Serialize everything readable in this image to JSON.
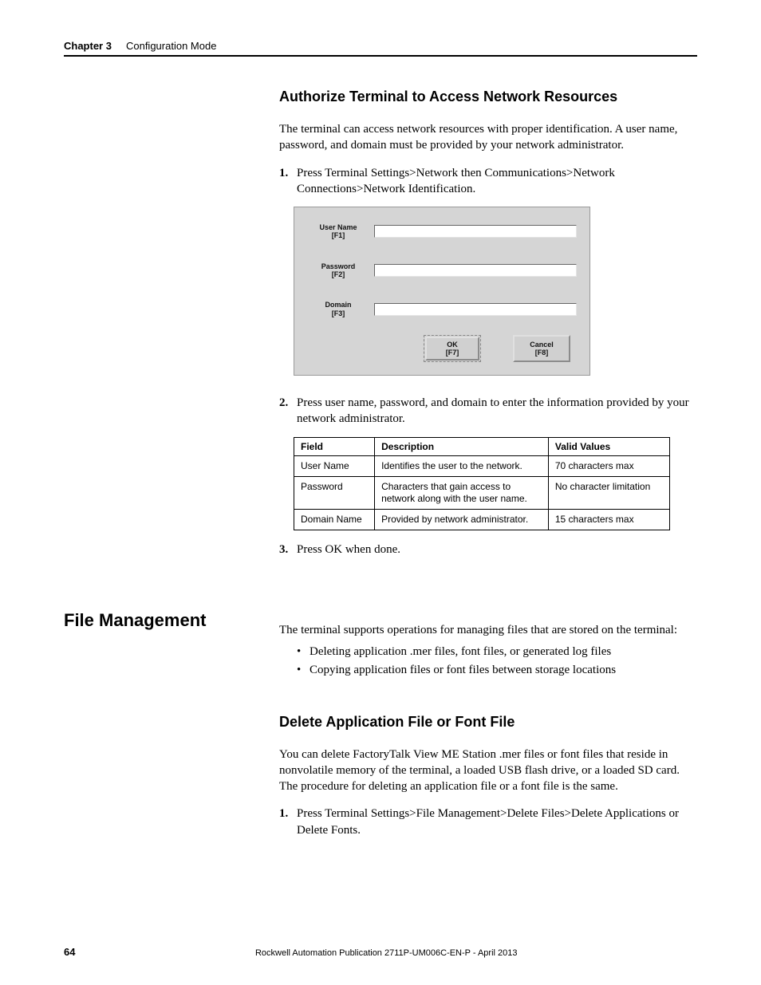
{
  "header": {
    "chapter_label": "Chapter 3",
    "chapter_title": "Configuration Mode"
  },
  "section1": {
    "heading": "Authorize Terminal to Access Network Resources",
    "intro": "The terminal can access network resources with proper identification. A user name, password, and domain must be provided by your network administrator.",
    "step1": "Press Terminal Settings>Network then Communications>Network Connections>Network Identification.",
    "step2": "Press user name, password, and domain to enter the information provided by your network administrator.",
    "step3": "Press OK when done."
  },
  "dialog": {
    "user_label": "User Name\n[F1]",
    "pass_label": "Password\n[F2]",
    "domain_label": "Domain\n[F3]",
    "ok_label": "OK\n[F7]",
    "cancel_label": "Cancel\n[F8]"
  },
  "table": {
    "headers": {
      "field": "Field",
      "desc": "Description",
      "valid": "Valid Values"
    },
    "rows": [
      {
        "field": "User Name",
        "desc": "Identifies the user to the network.",
        "valid": "70 characters max"
      },
      {
        "field": "Password",
        "desc": "Characters that gain access to network along with the user name.",
        "valid": "No character limitation"
      },
      {
        "field": "Domain Name",
        "desc": "Provided by network administrator.",
        "valid": "15 characters max"
      }
    ]
  },
  "section2": {
    "heading": "File Management",
    "intro": "The terminal supports operations for managing files that are stored on the terminal:",
    "bullets": [
      "Deleting application .mer files, font files, or generated log files",
      "Copying application files or font files between storage locations"
    ],
    "sub_heading": "Delete Application File or Font File",
    "sub_intro": "You can delete FactoryTalk View ME Station .mer files or font files that reside in nonvolatile memory of the terminal, a loaded USB flash drive, or a loaded SD card. The procedure for deleting an application file or a font file is the same.",
    "step1": "Press Terminal Settings>File Management>Delete Files>Delete Applications or Delete Fonts."
  },
  "footer": {
    "page": "64",
    "pub": "Rockwell Automation Publication 2711P-UM006C-EN-P - April 2013"
  }
}
